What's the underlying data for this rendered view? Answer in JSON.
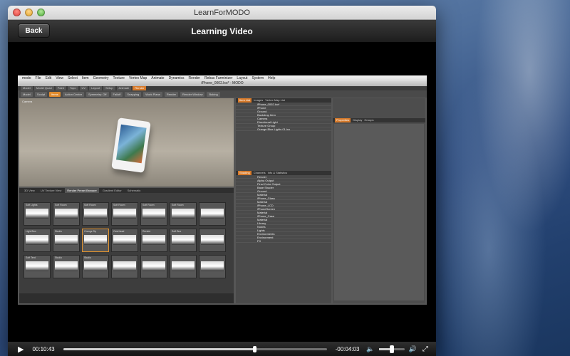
{
  "window": {
    "title": "LearnForMODO"
  },
  "navbar": {
    "back_label": "Back",
    "title": "Learning Video"
  },
  "recording": {
    "mac_menu": [
      "modo",
      "File",
      "Edit",
      "View",
      "Select",
      "Item",
      "Geometry",
      "Texture",
      "Vertex Map",
      "Animate",
      "Dynamics",
      "Render",
      "Rebus Farminizer",
      "Layout",
      "System",
      "Help"
    ],
    "modo_title": "iPhone_0002.lxo* - MODO",
    "tabs": [
      "Model",
      "Model Quad",
      "Paint",
      "Topo",
      "UV",
      "Layout",
      "Setup",
      "Animate",
      "Render"
    ],
    "active_tab": "Render",
    "toolbar": [
      "Model",
      "Sculpt",
      "Items",
      "Action Center",
      "Symmetry: Off",
      "Falloff",
      "Snapping",
      "Work Plane",
      "Render",
      "Render Window",
      "Baking"
    ],
    "viewport_label": "Camera",
    "browser_tabs": [
      "3D View",
      "UV Texture View",
      "Render Preset Browser",
      "Gradient Editor",
      "Schematic"
    ],
    "browser_active": "Render Preset Browser",
    "thumb_labels": [
      "Soft Lights",
      "Soft Room",
      "Soft Room",
      "Soft Room",
      "Soft Room",
      "Soft Room",
      "",
      "Light Box",
      "Studio",
      "Orange Sp",
      "Overhead",
      "Render",
      "Soft Box",
      "",
      "Soft Tent",
      "Studio",
      "Studio",
      "",
      "",
      "",
      ""
    ],
    "item_panel_tabs": [
      "Item List",
      "Images",
      "Vertex Map List"
    ],
    "item_tree": [
      "iPhone_0002.lxo*",
      "iPhone",
      "Ground",
      "Backdrop Item",
      "Camera",
      "Directional Light",
      "Texture Group",
      "Orange Blue Lights 01.lxo"
    ],
    "shader_tabs": [
      "Shading",
      "Channels",
      "Info & Statistics"
    ],
    "shader_tree": [
      "Render",
      "Alpha Output",
      "Final Color Output",
      "Base Shader",
      "Ground",
      "Material",
      "iPhone_Glass",
      "Material",
      "iPhone_LCD",
      "iPhoneScreen",
      "Material",
      "iPhone_Case",
      "Material",
      "Library",
      "Nodes",
      "Lights",
      "Environments",
      "Environment",
      "FX"
    ],
    "props_tabs": [
      "Properties",
      "Display",
      "Groups"
    ]
  },
  "controls": {
    "elapsed": "00:10:43",
    "remaining": "-00:04:03",
    "progress": 0.726,
    "volume": 0.5
  },
  "icons": {
    "play": "play-icon",
    "volume_low": "volume-low-icon",
    "volume_high": "volume-high-icon",
    "fullscreen": "fullscreen-icon"
  }
}
